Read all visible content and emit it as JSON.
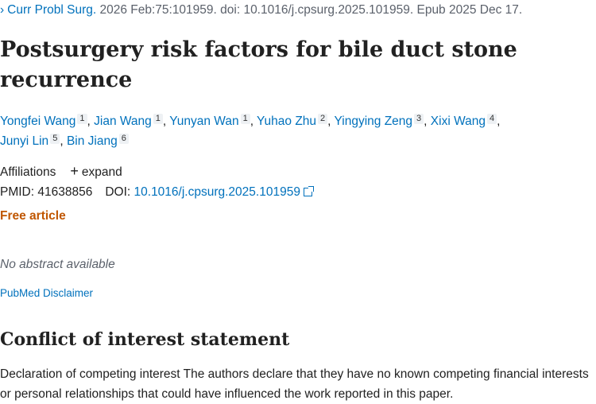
{
  "journal": {
    "chevron": "›",
    "name": "Curr Probl Surg.",
    "citation": " 2026 Feb:75:101959. doi: 10.1016/j.cpsurg.2025.101959. Epub 2025 Dec 17."
  },
  "title": "Postsurgery risk factors for bile duct stone recurrence",
  "authors": [
    {
      "name": "Yongfei Wang",
      "aff": "1"
    },
    {
      "name": "Jian Wang",
      "aff": "1"
    },
    {
      "name": "Yunyan Wan",
      "aff": "1"
    },
    {
      "name": "Yuhao Zhu",
      "aff": "2"
    },
    {
      "name": "Yingying Zeng",
      "aff": "3"
    },
    {
      "name": "Xixi Wang",
      "aff": "4"
    },
    {
      "name": "Junyi Lin",
      "aff": "5"
    },
    {
      "name": "Bin Jiang",
      "aff": "6"
    }
  ],
  "affiliations": {
    "label": "Affiliations",
    "plus": "+",
    "expand": "expand"
  },
  "ids": {
    "pmid_label": "PMID: 41638856",
    "doi_label": "DOI:",
    "doi": "10.1016/j.cpsurg.2025.101959"
  },
  "free_article": "Free article",
  "no_abstract": "No abstract available",
  "disclaimer": "PubMed Disclaimer",
  "coi": {
    "title": "Conflict of interest statement",
    "text": "Declaration of competing interest The authors declare that they have no known competing financial interests or personal relationships that could have influenced the work reported in this paper."
  },
  "colors": {
    "link": "#0071bc",
    "free": "#c05600",
    "muted": "#5b616b"
  },
  "icons": {
    "journal_chevron": "chevron-right-icon",
    "external_link": "external-link-icon",
    "expand": "plus-icon"
  }
}
